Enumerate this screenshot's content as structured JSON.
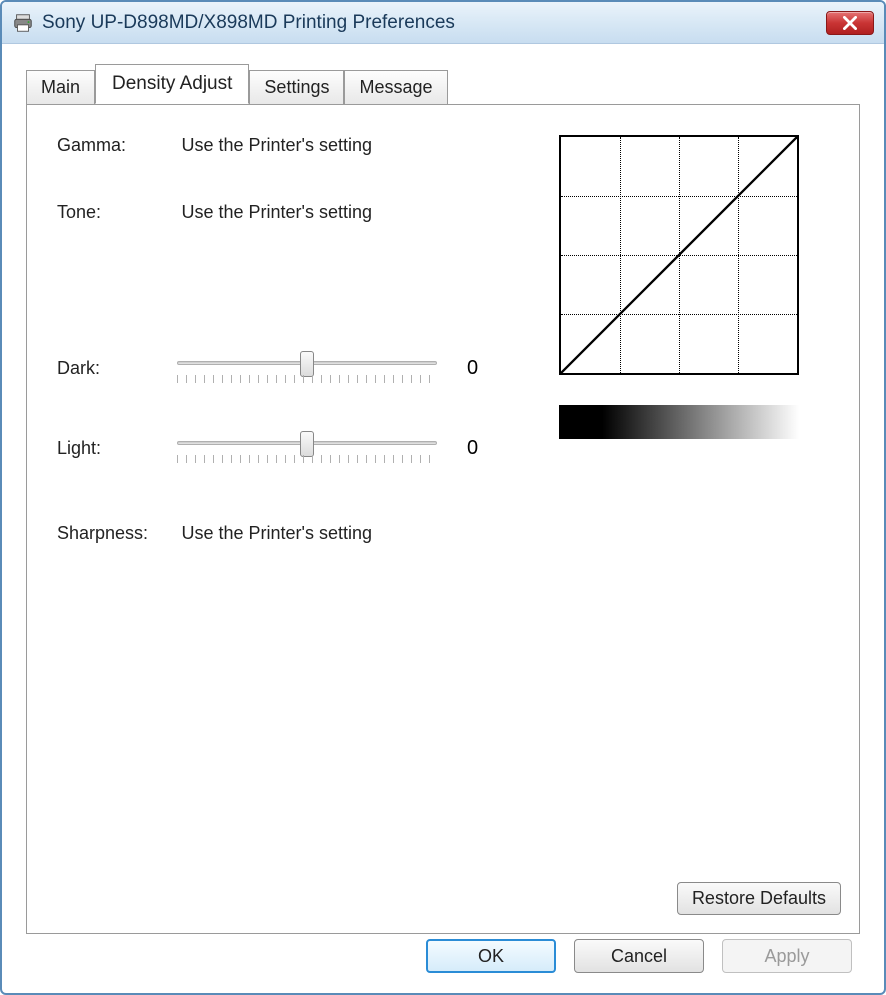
{
  "window": {
    "title": "Sony UP-D898MD/X898MD Printing Preferences"
  },
  "tabs": {
    "main": "Main",
    "density_adjust": "Density Adjust",
    "settings": "Settings",
    "message": "Message",
    "active": "density_adjust"
  },
  "density": {
    "gamma_label": "Gamma:",
    "gamma_value": "Use the Printer's setting",
    "tone_label": "Tone:",
    "tone_value": "Use the Printer's setting",
    "dark_label": "Dark:",
    "dark_value": "0",
    "light_label": "Light:",
    "light_value": "0",
    "sharpness_label": "Sharpness:",
    "sharpness_value": "Use the Printer's setting"
  },
  "buttons": {
    "restore_defaults": "Restore Defaults",
    "ok": "OK",
    "cancel": "Cancel",
    "apply": "Apply"
  },
  "chart_data": {
    "type": "line",
    "title": "",
    "xlabel": "",
    "ylabel": "",
    "x": [
      0,
      1
    ],
    "series": [
      {
        "name": "tone-curve",
        "values": [
          0,
          1
        ]
      }
    ],
    "xlim": [
      0,
      1
    ],
    "ylim": [
      0,
      1
    ],
    "grid": true
  }
}
